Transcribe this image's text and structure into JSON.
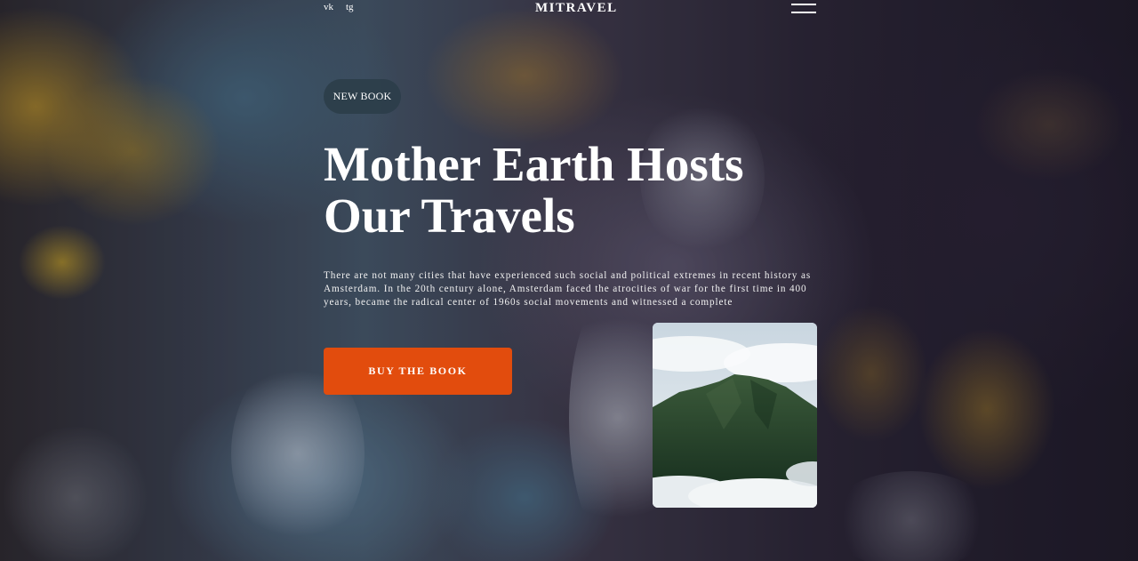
{
  "header": {
    "social_links": [
      "vk",
      "tg"
    ],
    "logo": "MITRAVEL"
  },
  "hero": {
    "badge": "NEW BOOK",
    "title_line1": "Mother Earth Hosts",
    "title_line2": "Our Travels",
    "description": "There are not many cities that have experienced such social and political extremes in recent history as Amsterdam. In the 20th century alone, Amsterdam faced the atrocities of war for the first time in 400 years, became the radical center of 1960s social movements and witnessed a complete",
    "cta_label": "BUY THE BOOK"
  },
  "icons": {
    "menu": "hamburger-menu-icon"
  },
  "colors": {
    "accent": "#e24c0d",
    "badge_bg": "#2c3e4a",
    "text": "#ffffff"
  }
}
